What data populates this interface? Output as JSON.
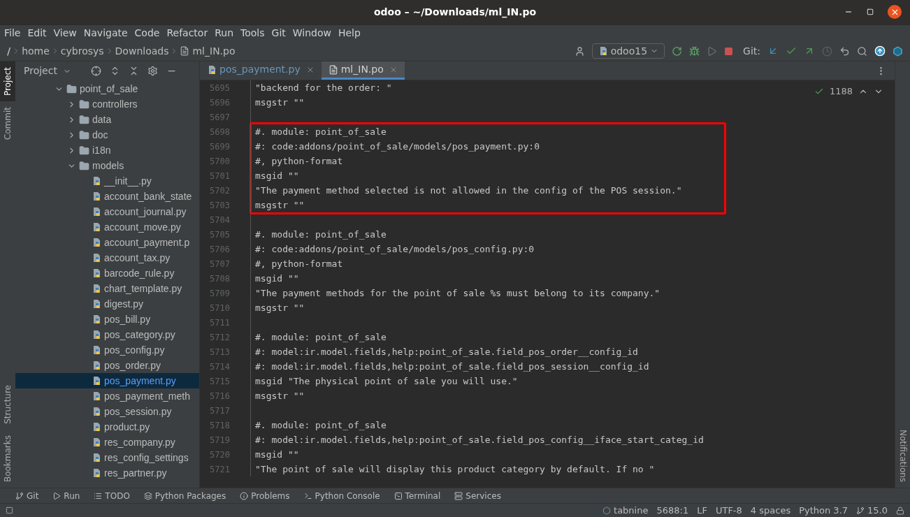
{
  "window": {
    "title": "odoo – ~/Downloads/ml_IN.po"
  },
  "menu": [
    "File",
    "Edit",
    "View",
    "Navigate",
    "Code",
    "Refactor",
    "Run",
    "Tools",
    "Git",
    "Window",
    "Help"
  ],
  "breadcrumb": [
    "/",
    "home",
    "cybrosys",
    "Downloads",
    "ml_IN.po"
  ],
  "run_config": "odoo15",
  "git_label": "Git:",
  "left_strip": [
    {
      "label": "Project",
      "selected": true
    },
    {
      "label": "Commit",
      "selected": false
    },
    {
      "label": "Structure",
      "selected": false
    },
    {
      "label": "Bookmarks",
      "selected": false
    }
  ],
  "right_strip": [
    "Notifications"
  ],
  "project_panel": {
    "title": "Project",
    "tree": [
      {
        "label": "point_of_sale",
        "kind": "folder",
        "expanded": true,
        "selected": false,
        "children": [
          {
            "label": "controllers",
            "kind": "folder",
            "expanded": false,
            "selected": false
          },
          {
            "label": "data",
            "kind": "folder",
            "expanded": false,
            "selected": false
          },
          {
            "label": "doc",
            "kind": "folder",
            "expanded": false,
            "selected": false
          },
          {
            "label": "i18n",
            "kind": "folder",
            "expanded": false,
            "selected": false
          },
          {
            "label": "models",
            "kind": "folder",
            "expanded": true,
            "selected": false,
            "children": [
              {
                "label": "__init__.py",
                "kind": "file",
                "selected": false
              },
              {
                "label": "account_bank_state",
                "kind": "file",
                "selected": false
              },
              {
                "label": "account_journal.py",
                "kind": "file",
                "selected": false
              },
              {
                "label": "account_move.py",
                "kind": "file",
                "selected": false
              },
              {
                "label": "account_payment.p",
                "kind": "file",
                "selected": false
              },
              {
                "label": "account_tax.py",
                "kind": "file",
                "selected": false
              },
              {
                "label": "barcode_rule.py",
                "kind": "file",
                "selected": false
              },
              {
                "label": "chart_template.py",
                "kind": "file",
                "selected": false
              },
              {
                "label": "digest.py",
                "kind": "file",
                "selected": false
              },
              {
                "label": "pos_bill.py",
                "kind": "file",
                "selected": false
              },
              {
                "label": "pos_category.py",
                "kind": "file",
                "selected": false
              },
              {
                "label": "pos_config.py",
                "kind": "file",
                "selected": false
              },
              {
                "label": "pos_order.py",
                "kind": "file",
                "selected": false
              },
              {
                "label": "pos_payment.py",
                "kind": "file",
                "selected": true
              },
              {
                "label": "pos_payment_meth",
                "kind": "file",
                "selected": false
              },
              {
                "label": "pos_session.py",
                "kind": "file",
                "selected": false
              },
              {
                "label": "product.py",
                "kind": "file",
                "selected": false
              },
              {
                "label": "res_company.py",
                "kind": "file",
                "selected": false
              },
              {
                "label": "res_config_settings",
                "kind": "file",
                "selected": false
              },
              {
                "label": "res_partner.py",
                "kind": "file",
                "selected": false
              }
            ]
          }
        ]
      }
    ]
  },
  "editor_tabs": [
    {
      "label": "pos_payment.py",
      "kind": "python",
      "selected": false
    },
    {
      "label": "ml_IN.po",
      "kind": "text",
      "selected": true
    }
  ],
  "inspection_count": "1188",
  "lines": [
    {
      "number": "5695",
      "text": "\"backend for the order: \"",
      "boxed": false
    },
    {
      "number": "5696",
      "text": "msgstr \"\"",
      "boxed": false
    },
    {
      "number": "5697",
      "boxed": false
    },
    {
      "number": "5698",
      "text": "#. module: point_of_sale",
      "boxed": true
    },
    {
      "number": "5699",
      "text": "#: code:addons/point_of_sale/models/pos_payment.py:0",
      "boxed": true
    },
    {
      "number": "5700",
      "text": "#, python-format",
      "boxed": true
    },
    {
      "number": "5701",
      "text": "msgid \"\"",
      "boxed": true
    },
    {
      "number": "5702",
      "text": "\"The payment method selected is not allowed in the config of the POS session.\"",
      "boxed": true
    },
    {
      "number": "5703",
      "text": "msgstr \"\"",
      "boxed": true
    },
    {
      "number": "5704",
      "boxed": false
    },
    {
      "number": "5705",
      "text": "#. module: point_of_sale",
      "boxed": false
    },
    {
      "number": "5706",
      "text": "#: code:addons/point_of_sale/models/pos_config.py:0",
      "boxed": false
    },
    {
      "number": "5707",
      "text": "#, python-format",
      "boxed": false
    },
    {
      "number": "5708",
      "text": "msgid \"\"",
      "boxed": false
    },
    {
      "number": "5709",
      "text": "\"The payment methods for the point of sale %s must belong to its company.\"",
      "boxed": false
    },
    {
      "number": "5710",
      "text": "msgstr \"\"",
      "boxed": false
    },
    {
      "number": "5711",
      "boxed": false
    },
    {
      "number": "5712",
      "text": "#. module: point_of_sale",
      "boxed": false
    },
    {
      "number": "5713",
      "text": "#: model:ir.model.fields,help:point_of_sale.field_pos_order__config_id",
      "boxed": false
    },
    {
      "number": "5714",
      "text": "#: model:ir.model.fields,help:point_of_sale.field_pos_session__config_id",
      "boxed": false
    },
    {
      "number": "5715",
      "text": "msgid \"The physical point of sale you will use.\"",
      "boxed": false
    },
    {
      "number": "5716",
      "text": "msgstr \"\"",
      "boxed": false
    },
    {
      "number": "5717",
      "boxed": false
    },
    {
      "number": "5718",
      "text": "#. module: point_of_sale",
      "boxed": false
    },
    {
      "number": "5719",
      "text": "#: model:ir.model.fields,help:point_of_sale.field_pos_config__iface_start_categ_id",
      "boxed": false
    },
    {
      "number": "5720",
      "text": "msgid \"\"",
      "boxed": false
    },
    {
      "number": "5721",
      "text": "\"The point of sale will display this product category by default. If no \"",
      "boxed": false
    }
  ],
  "tool_windows": [
    {
      "label": "Git",
      "kind": "git"
    },
    {
      "label": "Run",
      "kind": "run"
    },
    {
      "label": "TODO",
      "kind": "todo"
    },
    {
      "label": "Python Packages",
      "kind": "packages"
    },
    {
      "label": "Problems",
      "kind": "problems"
    },
    {
      "label": "Python Console",
      "kind": "console"
    },
    {
      "label": "Terminal",
      "kind": "terminal"
    },
    {
      "label": "Services",
      "kind": "services"
    }
  ],
  "status_bar": {
    "plugin": "tabnine",
    "items": [
      "5688:1",
      "LF",
      "UTF-8",
      "4 spaces",
      "Python 3.7"
    ],
    "branch": "15.0"
  }
}
